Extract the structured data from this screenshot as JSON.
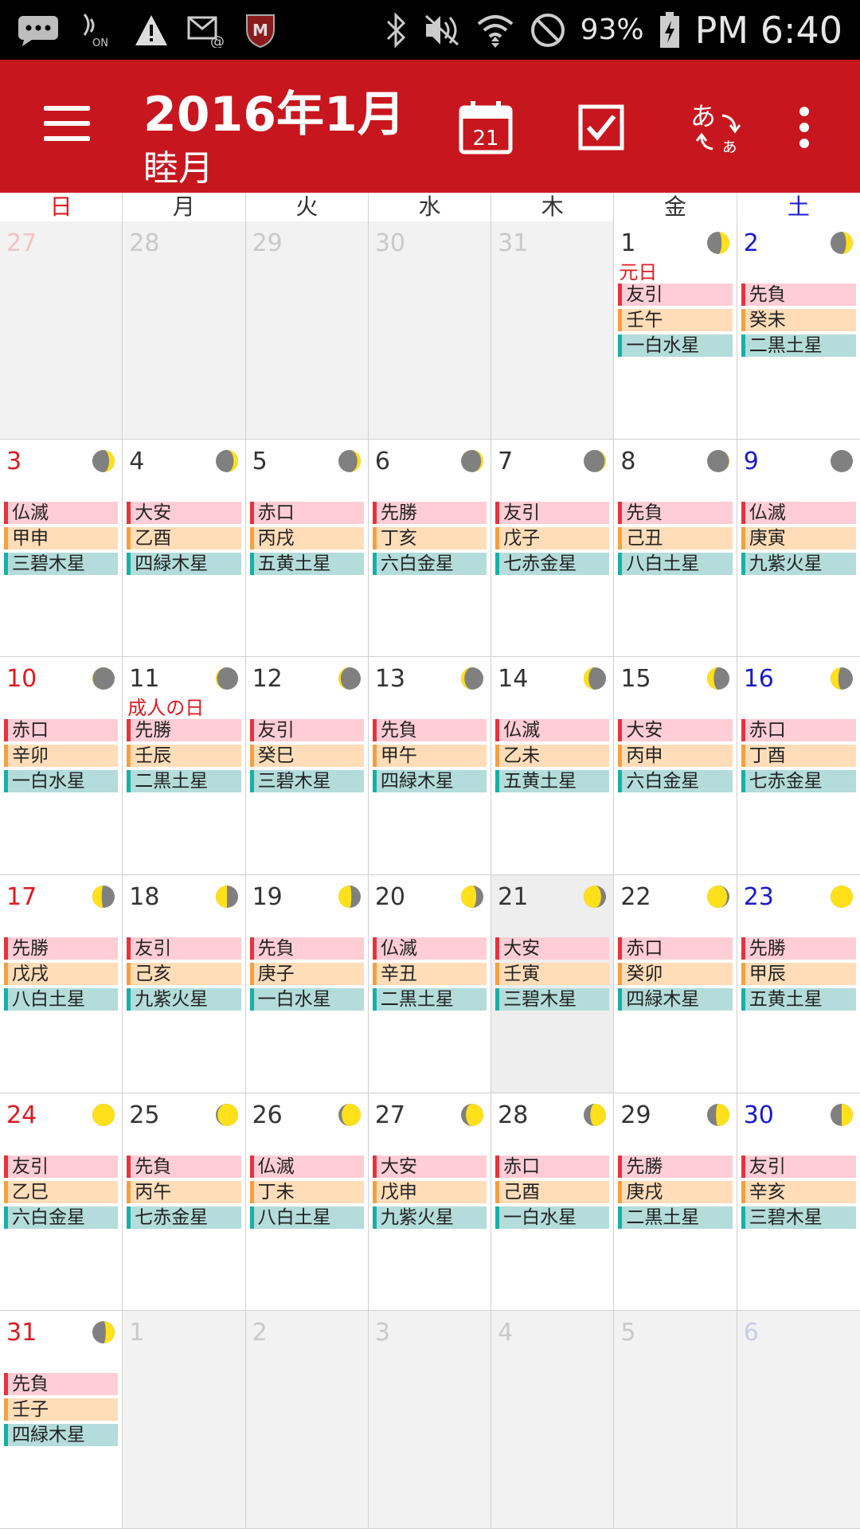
{
  "status_bar": {
    "time": "PM 6:40",
    "battery": "93%",
    "icons": [
      "messaging-icon",
      "nfc-icon",
      "warning-icon",
      "email-icon",
      "mcafee-icon",
      "bluetooth-icon",
      "mute-icon",
      "wifi-icon",
      "do-not-disturb-icon",
      "battery-icon"
    ]
  },
  "app_bar": {
    "title": "2016年1月",
    "subtitle": "睦月",
    "calendar_today_day": "21",
    "icons": [
      "menu-icon",
      "calendar-today-icon",
      "task-checkbox-icon",
      "japanese-translate-icon",
      "more-vert-icon"
    ]
  },
  "colors": {
    "appbar": "#c8161e",
    "sunday": "#e0191f",
    "saturday": "#1a1ad0",
    "rokuyo_bg": "#ffcdd6",
    "kanshi_bg": "#ffddb8",
    "kyusei_bg": "#b3dcdb",
    "moon_light": "#ffe01a",
    "moon_dark": "#808080"
  },
  "weekdays": [
    "日",
    "月",
    "火",
    "水",
    "木",
    "金",
    "土"
  ],
  "days": [
    {
      "d": "27",
      "other": true
    },
    {
      "d": "28",
      "other": true
    },
    {
      "d": "29",
      "other": true
    },
    {
      "d": "30",
      "other": true
    },
    {
      "d": "31",
      "other": true
    },
    {
      "d": "1",
      "holiday": "元日",
      "moon": 0.35,
      "rokuyo": "友引",
      "kanshi": "壬午",
      "kyusei": "一白水星"
    },
    {
      "d": "2",
      "moon": 0.3,
      "rokuyo": "先負",
      "kanshi": "癸未",
      "kyusei": "二黒土星"
    },
    {
      "d": "3",
      "moon": 0.25,
      "rokuyo": "仏滅",
      "kanshi": "甲申",
      "kyusei": "三碧木星"
    },
    {
      "d": "4",
      "moon": 0.2,
      "rokuyo": "大安",
      "kanshi": "乙酉",
      "kyusei": "四緑木星"
    },
    {
      "d": "5",
      "moon": 0.15,
      "rokuyo": "赤口",
      "kanshi": "丙戌",
      "kyusei": "五黄土星"
    },
    {
      "d": "6",
      "moon": 0.1,
      "rokuyo": "先勝",
      "kanshi": "丁亥",
      "kyusei": "六白金星"
    },
    {
      "d": "7",
      "moon": 0.06,
      "rokuyo": "友引",
      "kanshi": "戊子",
      "kyusei": "七赤金星"
    },
    {
      "d": "8",
      "moon": 0.02,
      "rokuyo": "先負",
      "kanshi": "己丑",
      "kyusei": "八白土星"
    },
    {
      "d": "9",
      "moon": 0,
      "rokuyo": "仏滅",
      "kanshi": "庚寅",
      "kyusei": "九紫火星"
    },
    {
      "d": "10",
      "moon": -0.02,
      "rokuyo": "赤口",
      "kanshi": "辛卯",
      "kyusei": "一白水星"
    },
    {
      "d": "11",
      "holiday": "成人の日",
      "moon": -0.06,
      "rokuyo": "先勝",
      "kanshi": "壬辰",
      "kyusei": "二黒土星"
    },
    {
      "d": "12",
      "moon": -0.1,
      "rokuyo": "友引",
      "kanshi": "癸巳",
      "kyusei": "三碧木星"
    },
    {
      "d": "13",
      "moon": -0.15,
      "rokuyo": "先負",
      "kanshi": "甲午",
      "kyusei": "四緑木星"
    },
    {
      "d": "14",
      "moon": -0.22,
      "rokuyo": "仏滅",
      "kanshi": "乙未",
      "kyusei": "五黄土星"
    },
    {
      "d": "15",
      "moon": -0.3,
      "rokuyo": "大安",
      "kanshi": "丙申",
      "kyusei": "六白金星"
    },
    {
      "d": "16",
      "moon": -0.35,
      "rokuyo": "赤口",
      "kanshi": "丁酉",
      "kyusei": "七赤金星"
    },
    {
      "d": "17",
      "moon": -0.42,
      "rokuyo": "先勝",
      "kanshi": "戊戌",
      "kyusei": "八白土星"
    },
    {
      "d": "18",
      "moon": -0.5,
      "rokuyo": "友引",
      "kanshi": "己亥",
      "kyusei": "九紫火星"
    },
    {
      "d": "19",
      "moon": -0.58,
      "rokuyo": "先負",
      "kanshi": "庚子",
      "kyusei": "一白水星"
    },
    {
      "d": "20",
      "moon": -0.68,
      "rokuyo": "仏滅",
      "kanshi": "辛丑",
      "kyusei": "二黒土星"
    },
    {
      "d": "21",
      "today": true,
      "moon": -0.78,
      "rokuyo": "大安",
      "kanshi": "壬寅",
      "kyusei": "三碧木星"
    },
    {
      "d": "22",
      "moon": -0.9,
      "rokuyo": "赤口",
      "kanshi": "癸卯",
      "kyusei": "四緑木星"
    },
    {
      "d": "23",
      "moon": -1,
      "rokuyo": "先勝",
      "kanshi": "甲辰",
      "kyusei": "五黄土星"
    },
    {
      "d": "24",
      "moon": 1,
      "rokuyo": "友引",
      "kanshi": "乙巳",
      "kyusei": "六白金星"
    },
    {
      "d": "25",
      "moon": 0.92,
      "rokuyo": "先負",
      "kanshi": "丙午",
      "kyusei": "七赤金星"
    },
    {
      "d": "26",
      "moon": 0.85,
      "rokuyo": "仏滅",
      "kanshi": "丁未",
      "kyusei": "八白土星"
    },
    {
      "d": "27",
      "moon": 0.78,
      "rokuyo": "大安",
      "kanshi": "戊申",
      "kyusei": "九紫火星"
    },
    {
      "d": "28",
      "moon": 0.7,
      "rokuyo": "赤口",
      "kanshi": "己酉",
      "kyusei": "一白水星"
    },
    {
      "d": "29",
      "moon": 0.6,
      "rokuyo": "先勝",
      "kanshi": "庚戌",
      "kyusei": "二黒土星"
    },
    {
      "d": "30",
      "moon": 0.5,
      "rokuyo": "友引",
      "kanshi": "辛亥",
      "kyusei": "三碧木星"
    },
    {
      "d": "31",
      "moon": 0.4,
      "rokuyo": "先負",
      "kanshi": "壬子",
      "kyusei": "四緑木星"
    },
    {
      "d": "1",
      "other": true
    },
    {
      "d": "2",
      "other": true
    },
    {
      "d": "3",
      "other": true
    },
    {
      "d": "4",
      "other": true
    },
    {
      "d": "5",
      "other": true
    },
    {
      "d": "6",
      "other": true
    }
  ]
}
